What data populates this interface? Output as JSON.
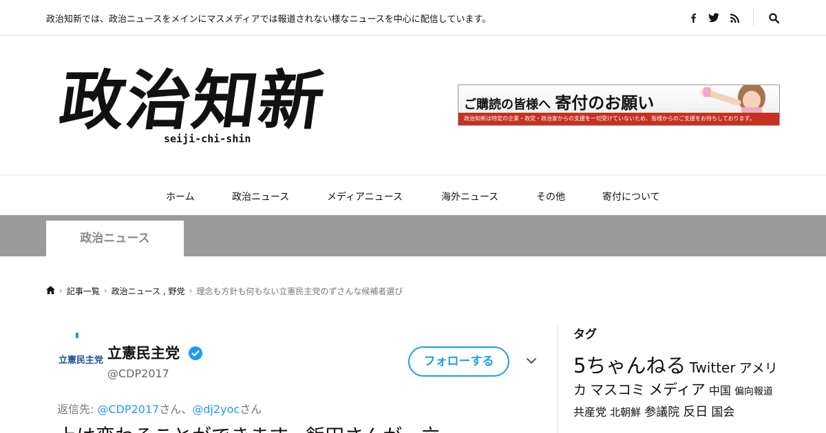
{
  "topbar": {
    "tagline": "政治知新では、政治ニュースをメインにマスメディアでは報道されない様なニュースを中心に配信しています。",
    "social_icons": [
      "facebook-icon",
      "twitter-icon",
      "rss-icon"
    ],
    "search_icon": "search-icon"
  },
  "header": {
    "logo_title": "政治知新",
    "logo_subtitle": "seiji-chi-shin",
    "banner": {
      "headline_small": "ご購読の皆様へ",
      "headline_big": "寄付のお願い",
      "footer": "政治知新は特定の企業・政党・政治家からの支援を一切受けていないため、皆様からのご支援をお待ちしております。"
    }
  },
  "nav": {
    "items": [
      "ホーム",
      "政治ニュース",
      "メディアニュース",
      "海外ニュース",
      "その他",
      "寄付について"
    ]
  },
  "category_tab": "政治ニュース",
  "breadcrumb": {
    "home_icon": "home-icon",
    "items": [
      "記事一覧",
      "政治ニュース",
      "野党"
    ],
    "separator": ",",
    "current": "理念も方針も何もない立憲民主党のずさんな候補者選び"
  },
  "tweet": {
    "logo_text": "立憲民主党",
    "account_name": "立憲民主党",
    "handle": "@CDP2017",
    "follow_label": "フォローする",
    "reply_prefix": "返信先: ",
    "reply_to_1": "@CDP2017",
    "reply_san_1": "さん、",
    "reply_to_2": "@dj2yoc",
    "reply_san_2": "さん",
    "text": "上は変わることができます。飯田さんが、立",
    "accent": "#1d9bf0"
  },
  "sidebar": {
    "heading": "タグ",
    "tags": [
      "5ちゃんねる",
      "Twitter",
      "アメリカ",
      "マスコミ",
      "メディア",
      "中国",
      "偏向報道",
      "共産党",
      "北朝鮮",
      "参議院",
      "反日",
      "国会"
    ]
  }
}
